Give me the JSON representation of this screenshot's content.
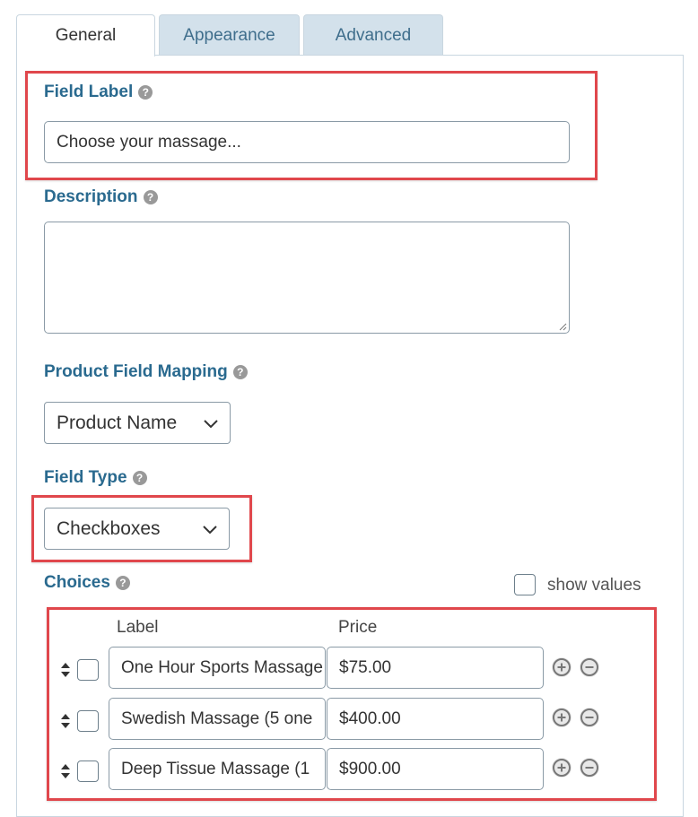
{
  "tabs": [
    {
      "label": "General",
      "active": true
    },
    {
      "label": "Appearance",
      "active": false
    },
    {
      "label": "Advanced",
      "active": false
    }
  ],
  "field_label": {
    "label": "Field Label",
    "value": "Choose your massage..."
  },
  "description": {
    "label": "Description",
    "value": ""
  },
  "product_mapping": {
    "label": "Product Field Mapping",
    "selected": "Product Name"
  },
  "field_type": {
    "label": "Field Type",
    "selected": "Checkboxes"
  },
  "choices": {
    "label": "Choices",
    "show_values_label": "show values",
    "show_values_checked": false,
    "col_label": "Label",
    "col_price": "Price",
    "rows": [
      {
        "label": "One Hour Sports Massage",
        "price": "$75.00",
        "checked": false
      },
      {
        "label": "Swedish Massage (5 one",
        "price": "$400.00",
        "checked": false
      },
      {
        "label": "Deep Tissue Massage (1",
        "price": "$900.00",
        "checked": false
      }
    ]
  },
  "icons": {
    "help": "question-circle-icon",
    "dropdown": "chevron-down-icon",
    "sort": "sort-arrows-icon",
    "add": "plus-circle-icon",
    "remove": "minus-circle-icon"
  },
  "colors": {
    "label_blue": "#2a6a8f",
    "highlight_red": "#e0474c",
    "inactive_tab": "#d3e1eb"
  }
}
